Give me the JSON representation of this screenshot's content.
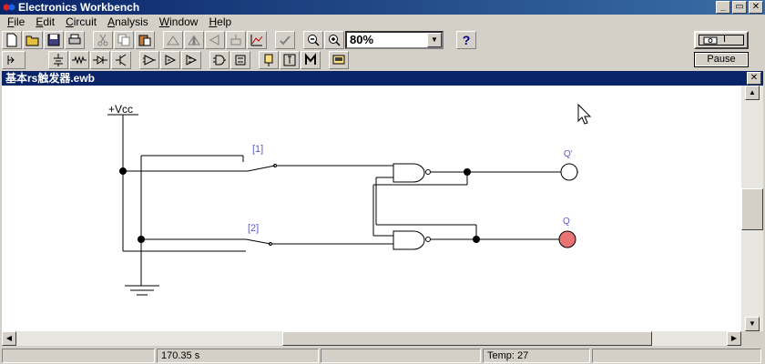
{
  "app": {
    "title": "Electronics Workbench"
  },
  "window_buttons": {
    "minimize": "_",
    "restore": "▭",
    "close": "✕"
  },
  "menu": [
    {
      "label": "File",
      "u": "F",
      "rest": "ile"
    },
    {
      "label": "Edit",
      "u": "E",
      "rest": "dit"
    },
    {
      "label": "Circuit",
      "u": "C",
      "rest": "ircuit"
    },
    {
      "label": "Analysis",
      "u": "A",
      "rest": "nalysis"
    },
    {
      "label": "Window",
      "u": "W",
      "rest": "indow"
    },
    {
      "label": "Help",
      "u": "H",
      "rest": "elp"
    }
  ],
  "toolbar": {
    "zoom_value": "80%",
    "zoom_arrow": "▼",
    "help_label": "?"
  },
  "simulation": {
    "power_on_label": "I",
    "pause_label": "Pause"
  },
  "document": {
    "title": "基本rs触发器.ewb",
    "close": "✕"
  },
  "circuit": {
    "supply_label": "+Vcc",
    "switch1_label": "[1]",
    "switch2_label": "[2]",
    "qbar_label": "Q'",
    "q_label": "Q",
    "qbar_color": "#ffffff",
    "q_color": "#e87474",
    "label_color": "#5a5ad0"
  },
  "scroll": {
    "up": "▲",
    "down": "▼",
    "left": "◀",
    "right": "▶"
  },
  "status": {
    "empty1": "",
    "time": "170.35 s",
    "empty2": "",
    "temp": "Temp:  27",
    "empty3": ""
  }
}
